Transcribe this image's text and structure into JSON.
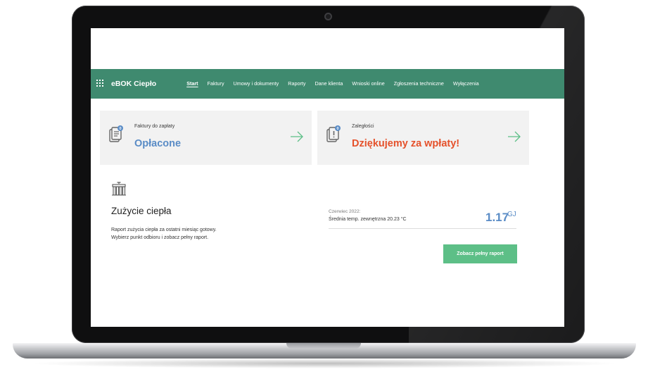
{
  "app": {
    "brand": "eBOK Ciepło",
    "nav": [
      {
        "label": "Start",
        "active": true
      },
      {
        "label": "Faktury"
      },
      {
        "label": "Umowy i dokumenty"
      },
      {
        "label": "Raporty"
      },
      {
        "label": "Dane klienta"
      },
      {
        "label": "Wnioski online"
      },
      {
        "label": "Zgłoszenia techniczne"
      },
      {
        "label": "Wyłączenia"
      }
    ]
  },
  "cards": {
    "invoices": {
      "title": "Faktury do zapłaty",
      "value": "Opłacone",
      "badge": "0",
      "icon": "document-icon"
    },
    "arrears": {
      "title": "Zaległości",
      "value": "Dziękujemy za wpłaty!",
      "badge": "0",
      "icon": "alert-document-icon"
    }
  },
  "heat": {
    "icon": "radiator-icon",
    "title": "Zużycie ciepła",
    "desc_line1": "Raport zużycia ciepła za ostatni miesiąc gotowy.",
    "desc_line2": "Wybierz punkt odbioru i zobacz pełny raport.",
    "period": "Czerwiec 2022:",
    "temp_label": "Średnia temp. zewnętrzna 20.23 °C",
    "value": "1.17",
    "unit": "GJ",
    "button_label": "Zobacz pełny raport"
  },
  "colors": {
    "nav_green": "#3f8a6f",
    "accent_blue": "#5a8cc6",
    "accent_red": "#e5512b",
    "button_green": "#5dbf87"
  }
}
